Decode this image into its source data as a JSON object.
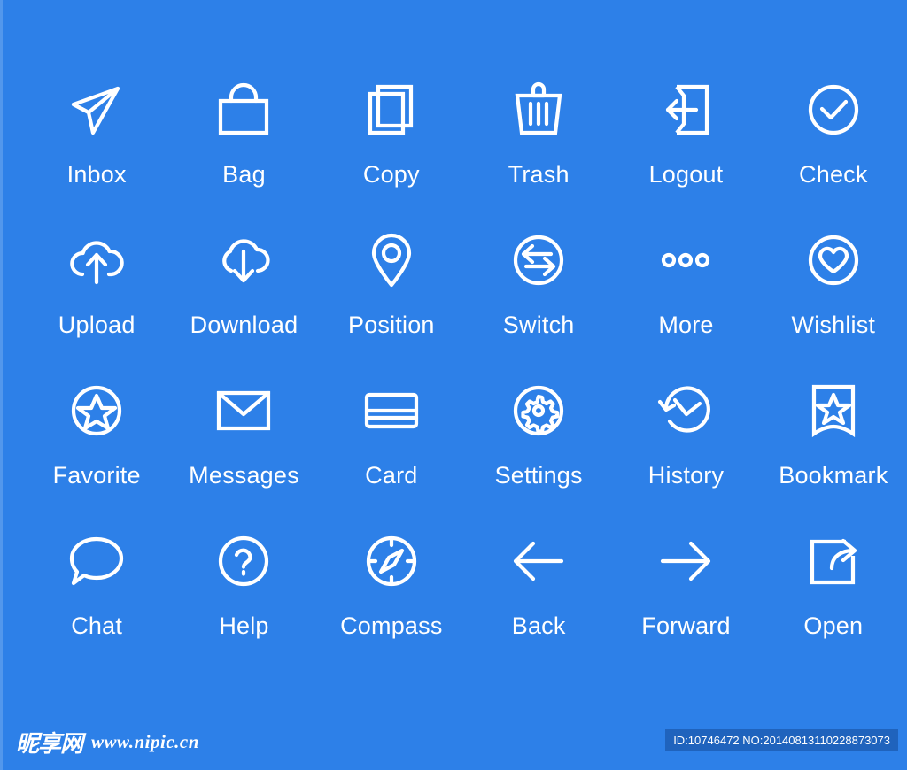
{
  "page": {
    "background_color": "#2d80e8",
    "icon_color": "#ffffff",
    "columns": 6,
    "rows": 4
  },
  "icons": [
    {
      "id": "inbox",
      "label": "Inbox",
      "icon_name": "paper-plane-icon"
    },
    {
      "id": "bag",
      "label": "Bag",
      "icon_name": "shopping-bag-icon"
    },
    {
      "id": "copy",
      "label": "Copy",
      "icon_name": "copy-pages-icon"
    },
    {
      "id": "trash",
      "label": "Trash",
      "icon_name": "trash-can-icon"
    },
    {
      "id": "logout",
      "label": "Logout",
      "icon_name": "logout-arrow-icon"
    },
    {
      "id": "check",
      "label": "Check",
      "icon_name": "check-circle-icon"
    },
    {
      "id": "upload",
      "label": "Upload",
      "icon_name": "cloud-upload-icon"
    },
    {
      "id": "download",
      "label": "Download",
      "icon_name": "cloud-download-icon"
    },
    {
      "id": "position",
      "label": "Position",
      "icon_name": "map-pin-icon"
    },
    {
      "id": "switch",
      "label": "Switch",
      "icon_name": "switch-arrows-circle-icon"
    },
    {
      "id": "more",
      "label": "More",
      "icon_name": "ellipsis-dots-icon"
    },
    {
      "id": "wishlist",
      "label": "Wishlist",
      "icon_name": "heart-circle-icon"
    },
    {
      "id": "favorite",
      "label": "Favorite",
      "icon_name": "star-circle-icon"
    },
    {
      "id": "messages",
      "label": "Messages",
      "icon_name": "envelope-icon"
    },
    {
      "id": "card",
      "label": "Card",
      "icon_name": "credit-card-icon"
    },
    {
      "id": "settings",
      "label": "Settings",
      "icon_name": "gear-circle-icon"
    },
    {
      "id": "history",
      "label": "History",
      "icon_name": "clock-rewind-icon"
    },
    {
      "id": "bookmark",
      "label": "Bookmark",
      "icon_name": "bookmark-star-icon"
    },
    {
      "id": "chat",
      "label": "Chat",
      "icon_name": "speech-bubble-icon"
    },
    {
      "id": "help",
      "label": "Help",
      "icon_name": "question-circle-icon"
    },
    {
      "id": "compass",
      "label": "Compass",
      "icon_name": "compass-icon"
    },
    {
      "id": "back",
      "label": "Back",
      "icon_name": "arrow-left-icon"
    },
    {
      "id": "forward",
      "label": "Forward",
      "icon_name": "arrow-right-icon"
    },
    {
      "id": "open",
      "label": "Open",
      "icon_name": "open-external-icon"
    }
  ],
  "footer": {
    "watermark_cn": "昵享网",
    "watermark_url": "www.nipic.cn",
    "id_text": "ID:10746472 NO:20140813110228873073",
    "badge_color": "#1f63bd"
  }
}
